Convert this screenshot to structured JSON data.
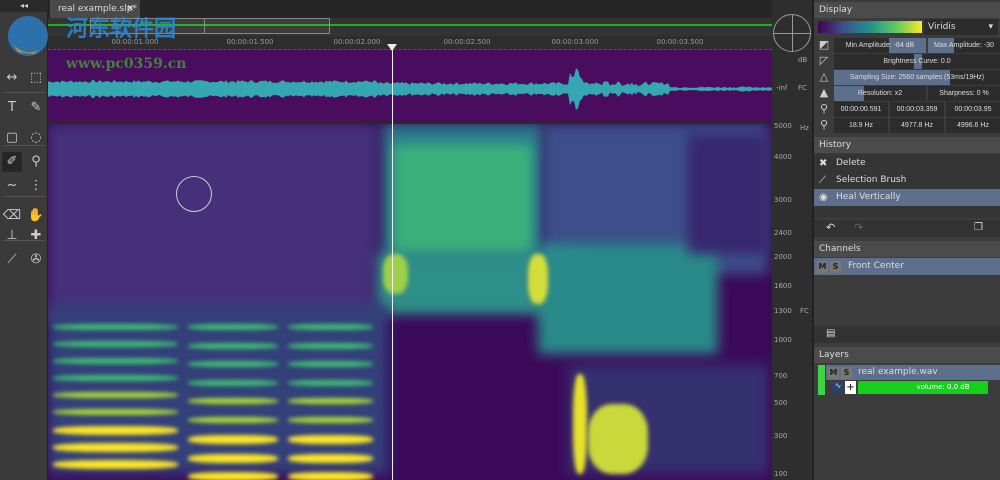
{
  "toolbar": {
    "collapse": "◂◂",
    "tools": [
      {
        "name": "move-tool",
        "glyph": "↔"
      },
      {
        "name": "zoom-box-tool",
        "glyph": "⬚"
      },
      {
        "name": "text-tool",
        "glyph": "T"
      },
      {
        "name": "eyedropper-tool",
        "glyph": "✎"
      },
      {
        "name": "rectangle-select-tool",
        "glyph": "▢"
      },
      {
        "name": "lasso-tool",
        "glyph": "◌"
      },
      {
        "name": "brush-select-tool",
        "glyph": "✐"
      },
      {
        "name": "magic-wand-tool",
        "glyph": "⚲"
      },
      {
        "name": "line-tool",
        "glyph": "∼"
      },
      {
        "name": "dotted-line-tool",
        "glyph": "⋮"
      },
      {
        "name": "eraser-tool",
        "glyph": "⌫"
      },
      {
        "name": "smudge-tool",
        "glyph": "✋"
      },
      {
        "name": "stamp-tool",
        "glyph": "⊥"
      },
      {
        "name": "heal-tool",
        "glyph": "✚"
      },
      {
        "name": "pen-tool",
        "glyph": "⟋"
      },
      {
        "name": "spray-tool",
        "glyph": "✇"
      }
    ]
  },
  "tab": {
    "label": "real example.slp*",
    "close": "✕"
  },
  "ruler": {
    "ticks": [
      "00:00:01.000",
      "00:00:01.500",
      "00:00:02.000",
      "00:00:02.500",
      "00:00:03.000",
      "00:00:03.500"
    ]
  },
  "wave_axis": {
    "db": "dB",
    "inf": "-inf",
    "channel": "FC"
  },
  "freq_axis": {
    "unit": "Hz",
    "channel": "FC",
    "labels": [
      "5000",
      "4000",
      "3000",
      "2400",
      "2000",
      "1600",
      "1300",
      "1000",
      "700",
      "500",
      "300",
      "100"
    ]
  },
  "watermark": {
    "title": "河东软件园",
    "url": "www.pc0359.cn"
  },
  "display": {
    "header": "Display",
    "colormap": "Viridis",
    "min_amplitude": "Min Amplitude: -84 dB",
    "max_amplitude": "Max Amplitude: -30",
    "brightness": "Brightness Curve: 0.0",
    "sampling": "Sampling Size: 2560 samples (53ms/19Hz)",
    "resolution": "Resolution: x2",
    "sharpness": "Sharpness: 0 %",
    "time_start": "00:00:00.591",
    "time_end": "00:00:03.359",
    "time_len": "00:00:03.95",
    "freq_low": "18.9  Hz",
    "freq_high": "4977.8  Hz",
    "freq_range": "4996.6  Hz"
  },
  "history": {
    "header": "History",
    "items": [
      {
        "label": "Delete",
        "icon": "✖"
      },
      {
        "label": "Selection Brush",
        "icon": "⟋"
      },
      {
        "label": "Heal Vertically",
        "icon": "◉"
      }
    ]
  },
  "channels": {
    "header": "Channels",
    "items": [
      {
        "m": "M",
        "s": "S",
        "label": "Front Center"
      }
    ]
  },
  "layers": {
    "header": "Layers",
    "items": [
      {
        "m": "M",
        "s": "S",
        "label": "real example.wav",
        "add": "+",
        "volume": "volume: 0.0 dB"
      }
    ]
  },
  "colors": {
    "accent": "#1db31d",
    "selection": "#5e6f8c"
  }
}
